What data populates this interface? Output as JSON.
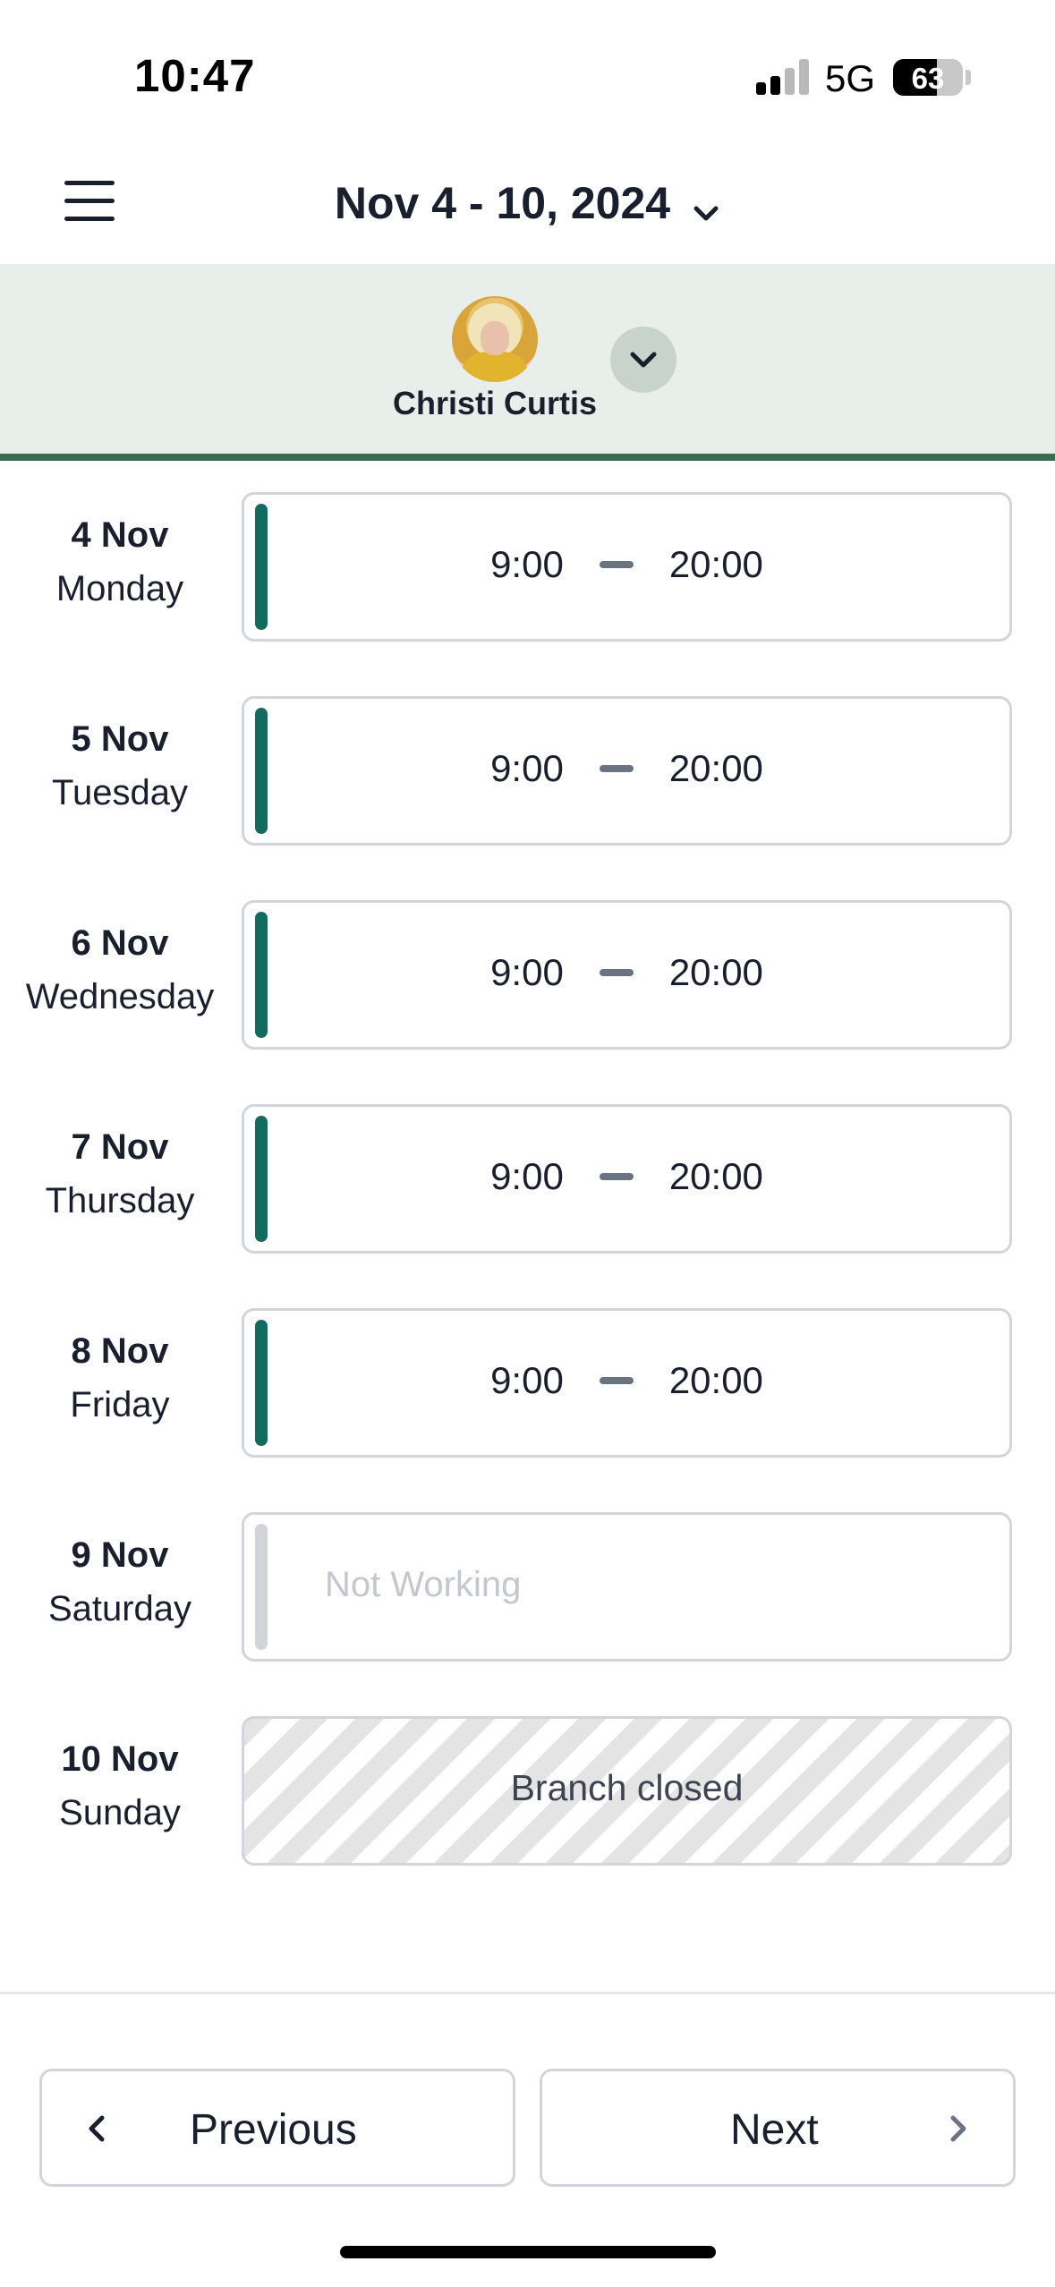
{
  "status_bar": {
    "time": "10:47",
    "network": "5G",
    "battery_percent": "63",
    "battery_level": 0.63
  },
  "header": {
    "date_range": "Nov 4 - 10, 2024",
    "menu_icon": "hamburger-menu-icon",
    "dropdown_icon": "chevron-down-icon"
  },
  "staff": {
    "name": "Christi Curtis",
    "dropdown_icon": "chevron-down-icon"
  },
  "days": [
    {
      "date": "4 Nov",
      "weekday": "Monday",
      "status": "working",
      "start": "9:00",
      "end": "20:00"
    },
    {
      "date": "5 Nov",
      "weekday": "Tuesday",
      "status": "working",
      "start": "9:00",
      "end": "20:00"
    },
    {
      "date": "6 Nov",
      "weekday": "Wednesday",
      "status": "working",
      "start": "9:00",
      "end": "20:00"
    },
    {
      "date": "7 Nov",
      "weekday": "Thursday",
      "status": "working",
      "start": "9:00",
      "end": "20:00"
    },
    {
      "date": "8 Nov",
      "weekday": "Friday",
      "status": "working",
      "start": "9:00",
      "end": "20:00"
    },
    {
      "date": "9 Nov",
      "weekday": "Saturday",
      "status": "off",
      "text": "Not Working"
    },
    {
      "date": "10 Nov",
      "weekday": "Sunday",
      "status": "closed",
      "text": "Branch closed"
    }
  ],
  "footer": {
    "previous_label": "Previous",
    "next_label": "Next"
  },
  "colors": {
    "accent_working": "#136b5f",
    "accent_off": "#d2d4d8",
    "staff_bar_bg": "#e8eeea",
    "staff_bar_border": "#3e6b4f"
  }
}
